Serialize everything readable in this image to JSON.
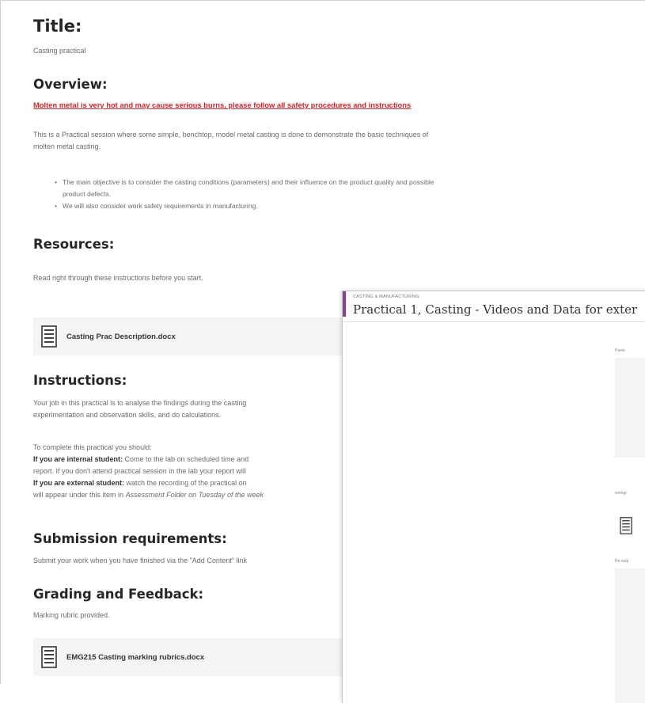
{
  "page": {
    "title_heading": "Title:",
    "title_value": "Casting practical",
    "overview_heading": "Overview:",
    "warning": "Molten metal is very hot and may cause serious burns, please follow all safety procedures and instructions",
    "overview_text_1": "This is a Practical session where some simple, benchtop, model metal casting is done to demonstrate the basic techniques of",
    "overview_text_2": "molten metal casting.",
    "bullets": [
      "The main objective is to consider the casting conditions (parameters) and their influence on the product quality and possible",
      "product defects.",
      "We will also consider work safety requirements in manufacturing."
    ],
    "resources_heading": "Resources:",
    "resources_text": "Read right through these instructions before you start.",
    "resource_file": "Casting Prac Description.docx",
    "instructions_heading": "Instructions:",
    "instructions_text_1": "Your job in this practical is to analyse the findings during the casting",
    "instructions_text_2": "experimentation and observation skills, and do calculations.",
    "instructions_text_3": "To complete this practical you should:",
    "internal_label": "If you are internal student:",
    "internal_text": " Come to the lab on scheduled time and",
    "internal_text_2": "report. If you don't attend practical session in the lab your report will",
    "external_label": "If you are external student:",
    "external_text": " watch the recording of the practical on",
    "external_text_2": "will appear under this item in ",
    "external_italic": "Assessment Folder on Tuesday of the week",
    "submission_heading": "Submission requirements:",
    "submission_text": "Submit your work when you have finished via the \"Add Content\" link",
    "grading_heading": "Grading and Feedback:",
    "grading_text": "Marking rubric provided.",
    "grading_file": "EMG215 Casting marking rubrics.docx"
  },
  "overlay": {
    "breadcrumb": "CASTING & MANUFACTURING",
    "title": "Practical 1, Casting - Videos and Data for exter",
    "label_top": "Paste",
    "label_mid": "workgr",
    "label_low": "Re-subj"
  },
  "colors": {
    "warning": "#d0262a",
    "accent": "#8c3f99"
  },
  "icons": {
    "doc": "document-icon"
  }
}
